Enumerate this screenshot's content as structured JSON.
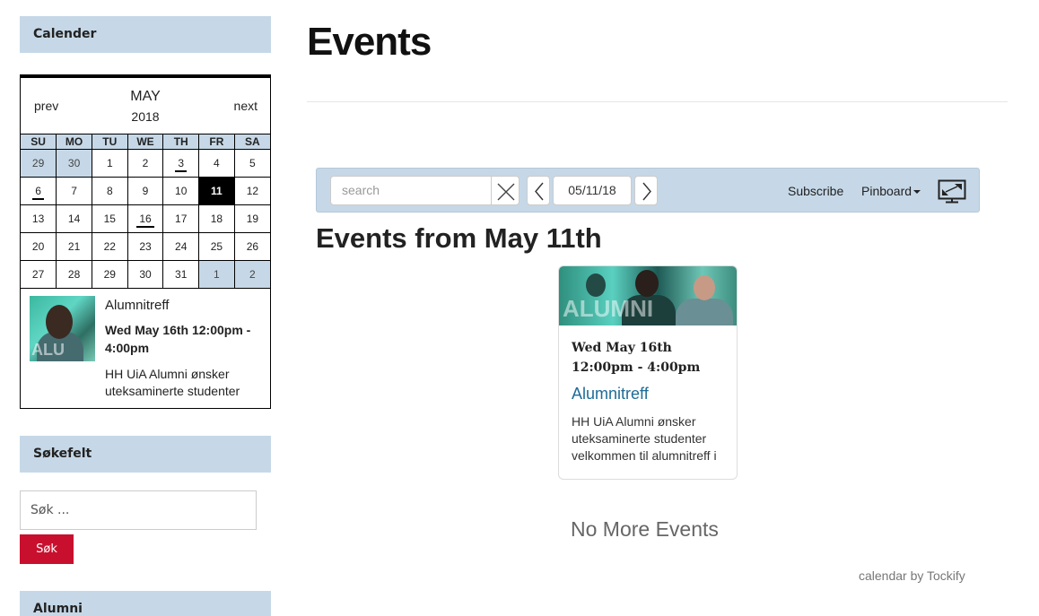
{
  "sidebar": {
    "calendar_title": "Calender",
    "search_title": "Søkefelt",
    "search_placeholder": "Søk ...",
    "search_button": "Søk",
    "alumni_title": "Alumni"
  },
  "calendar": {
    "prev": "prev",
    "next": "next",
    "month": "MAY",
    "year": "2018",
    "weekdays": [
      "SU",
      "MO",
      "TU",
      "WE",
      "TH",
      "FR",
      "SA"
    ],
    "weeks": [
      [
        "29",
        "30",
        "1",
        "2",
        "3",
        "4",
        "5"
      ],
      [
        "6",
        "7",
        "8",
        "9",
        "10",
        "11",
        "12"
      ],
      [
        "13",
        "14",
        "15",
        "16",
        "17",
        "18",
        "19"
      ],
      [
        "20",
        "21",
        "22",
        "23",
        "24",
        "25",
        "26"
      ],
      [
        "27",
        "28",
        "29",
        "30",
        "31",
        "1",
        "2"
      ]
    ],
    "event": {
      "title": "Alumnitreff",
      "time": "Wed May 16th 12:00pm - 4:00pm",
      "description": "HH UiA Alumni ønsker uteksaminerte studenter",
      "image_text": "ALU"
    }
  },
  "main": {
    "page_title": "Events",
    "toolbar": {
      "search_placeholder": "search",
      "date": "05/11/18",
      "subscribe": "Subscribe",
      "pinboard": "Pinboard"
    },
    "events_heading": "Events from May 11th",
    "card": {
      "image_text": "ALUMNI",
      "time": "Wed May 16th 12:00pm - 4:00pm",
      "title": "Alumnitreff",
      "description": "HH UiA Alumni ønsker uteksaminerte studenter velkommen til alumnitreff i"
    },
    "no_more": "No More Events",
    "credit": "calendar by Tockify"
  },
  "colors": {
    "accent": "#c6d8e7",
    "button": "#c8102e",
    "link": "#1e6c96"
  }
}
